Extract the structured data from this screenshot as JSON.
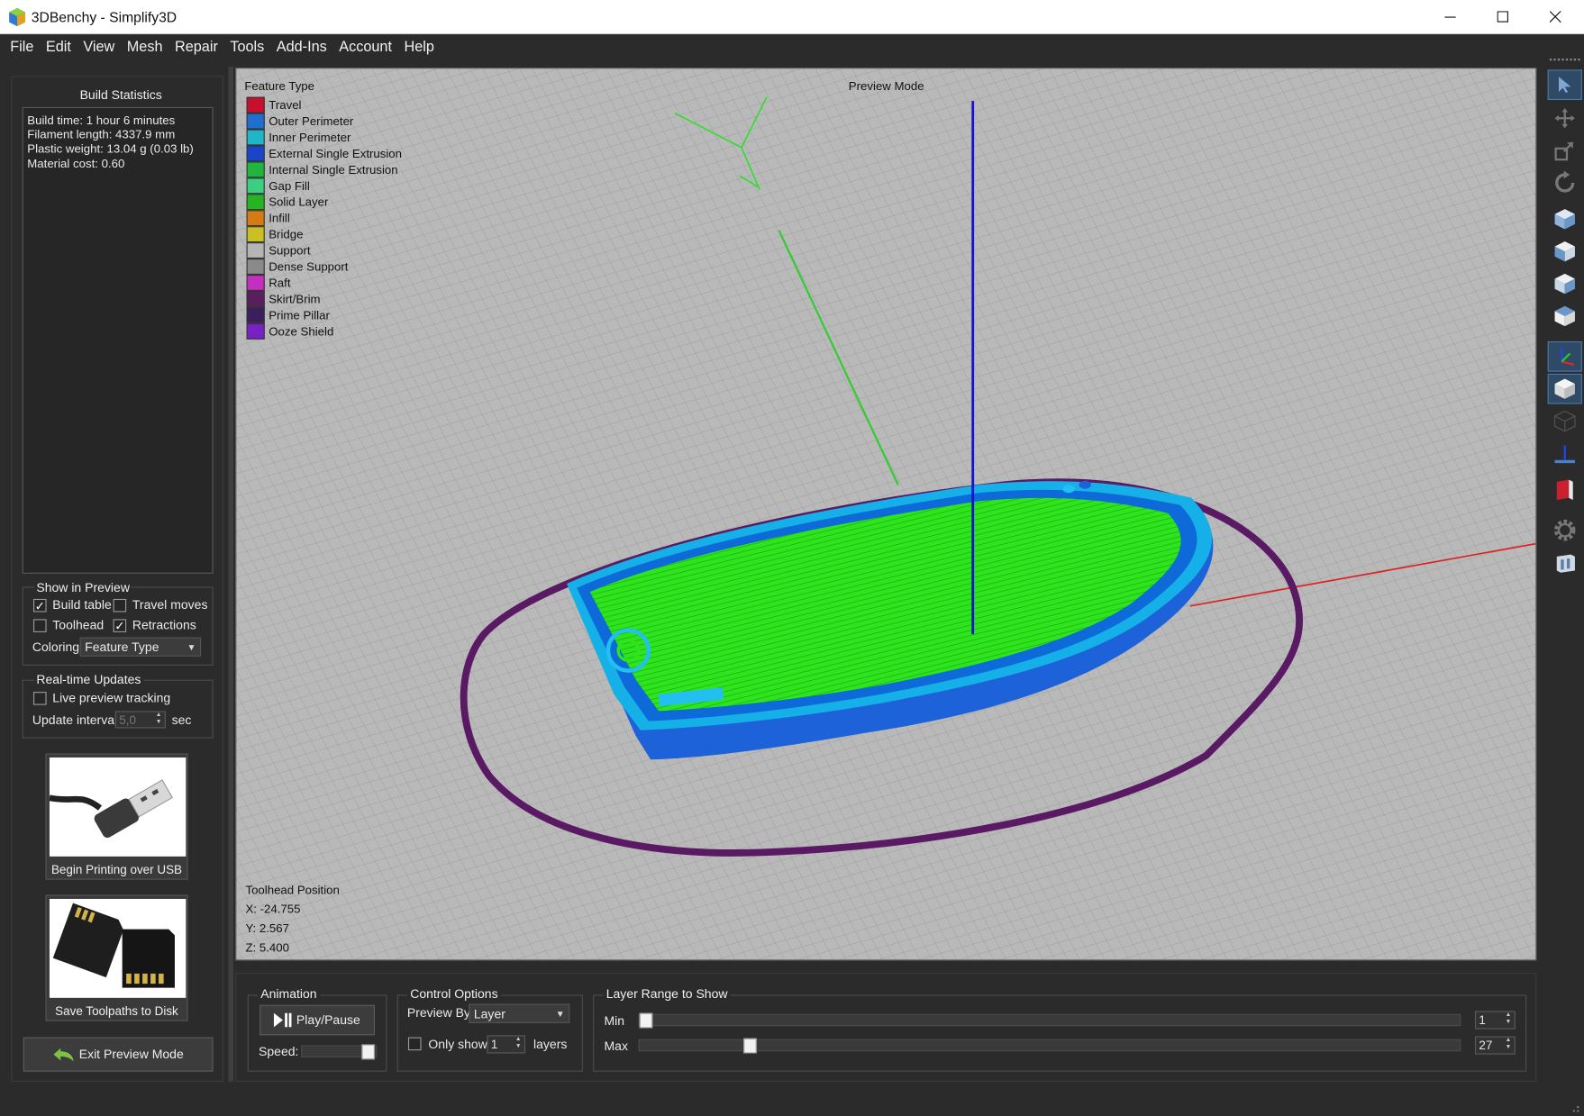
{
  "window": {
    "title": "3DBenchy - Simplify3D"
  },
  "menu": [
    "File",
    "Edit",
    "View",
    "Mesh",
    "Repair",
    "Tools",
    "Add-Ins",
    "Account",
    "Help"
  ],
  "build_statistics": {
    "title": "Build Statistics",
    "lines": [
      "Build time: 1 hour 6 minutes",
      "Filament length: 4337.9 mm",
      "Plastic weight: 13.04 g (0.03 lb)",
      "Material cost: 0.60"
    ]
  },
  "show_in_preview": {
    "title": "Show in Preview",
    "build_table": {
      "label": "Build table",
      "checked": true
    },
    "travel_moves": {
      "label": "Travel moves",
      "checked": false
    },
    "toolhead": {
      "label": "Toolhead",
      "checked": false
    },
    "retractions": {
      "label": "Retractions",
      "checked": true
    },
    "coloring_label": "Coloring",
    "coloring_value": "Feature Type"
  },
  "realtime_updates": {
    "title": "Real-time Updates",
    "live_preview": {
      "label": "Live preview tracking",
      "checked": false
    },
    "interval_label": "Update interval",
    "interval_value": "5,0",
    "interval_unit": "sec"
  },
  "actions": {
    "usb_label": "Begin Printing over USB",
    "sd_label": "Save Toolpaths to Disk",
    "exit_label": "Exit Preview Mode"
  },
  "viewport": {
    "mode_label": "Preview Mode",
    "legend_title": "Feature Type",
    "legend": [
      {
        "label": "Travel",
        "color": "#c8102e"
      },
      {
        "label": "Outer Perimeter",
        "color": "#1f6fd1"
      },
      {
        "label": "Inner Perimeter",
        "color": "#1fb6c9"
      },
      {
        "label": "External Single Extrusion",
        "color": "#1a44c9"
      },
      {
        "label": "Internal Single Extrusion",
        "color": "#22b53c"
      },
      {
        "label": "Gap Fill",
        "color": "#3ccf82"
      },
      {
        "label": "Solid Layer",
        "color": "#27b322"
      },
      {
        "label": "Infill",
        "color": "#d67a16"
      },
      {
        "label": "Bridge",
        "color": "#c9c023"
      },
      {
        "label": "Support",
        "color": "#b5b5b5"
      },
      {
        "label": "Dense Support",
        "color": "#8a8a8a"
      },
      {
        "label": "Raft",
        "color": "#c42fbf"
      },
      {
        "label": "Skirt/Brim",
        "color": "#5a1f5f"
      },
      {
        "label": "Prime Pillar",
        "color": "#3c1d5e"
      },
      {
        "label": "Ooze Shield",
        "color": "#7a21c4"
      }
    ],
    "toolhead_title": "Toolhead Position",
    "toolhead_x": "X: -24.755",
    "toolhead_y": "Y: 2.567",
    "toolhead_z": "Z: 5.400"
  },
  "animation": {
    "title": "Animation",
    "play_label": "Play/Pause",
    "speed_label": "Speed:"
  },
  "control_options": {
    "title": "Control Options",
    "preview_by_label": "Preview By",
    "preview_by_value": "Layer",
    "only_show_label": "Only show",
    "only_show_value": "1",
    "only_show_checked": false,
    "layers_label": "layers"
  },
  "layer_range": {
    "title": "Layer Range to Show",
    "min_label": "Min",
    "max_label": "Max",
    "min_value": "1",
    "max_value": "27"
  }
}
